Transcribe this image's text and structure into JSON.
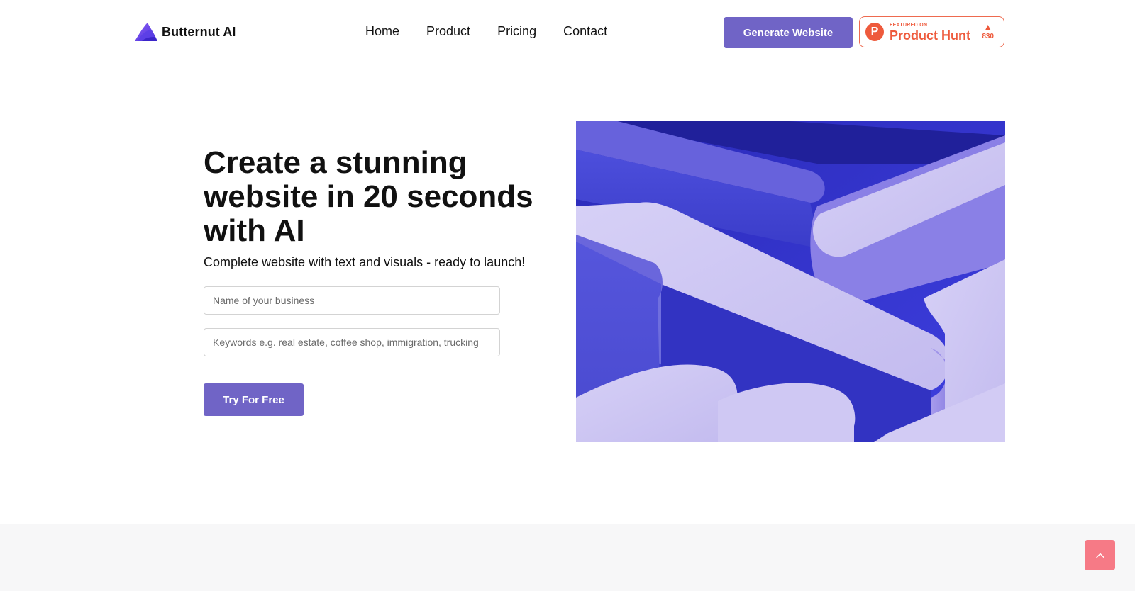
{
  "brand": {
    "name": "Butternut AI"
  },
  "nav": {
    "items": [
      {
        "label": "Home"
      },
      {
        "label": "Product"
      },
      {
        "label": "Pricing"
      },
      {
        "label": "Contact"
      }
    ]
  },
  "header": {
    "generate_label": "Generate Website",
    "product_hunt": {
      "logo_letter": "P",
      "featured_text": "FEATURED ON",
      "name": "Product Hunt",
      "upvote_icon": "triangle-up-icon",
      "votes": "830"
    }
  },
  "hero": {
    "title": "Create a stunning website in 20 seconds with AI",
    "subtitle": "Complete website with text and visuals - ready to launch!",
    "business_placeholder": "Name of your business",
    "keywords_placeholder": "Keywords e.g. real estate, coffee shop, immigration, trucking",
    "cta_label": "Try For Free"
  },
  "scroll_top": {
    "icon": "chevron-up-icon"
  },
  "colors": {
    "accent": "#7064c6",
    "product_hunt": "#ee5a3c",
    "scroll_top_bg": "#f67a86",
    "bottom_band": "#f7f7f8"
  }
}
